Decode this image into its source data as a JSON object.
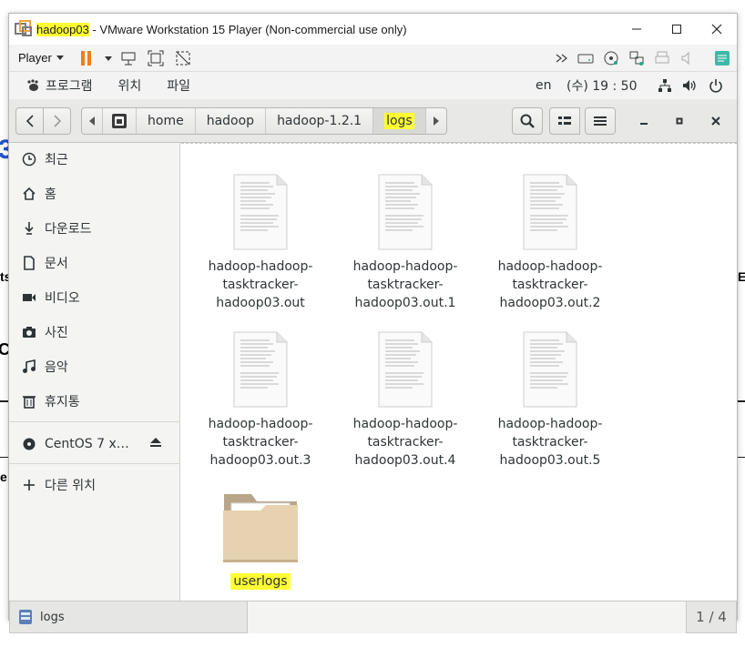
{
  "window": {
    "title_vm": "hadoop03",
    "title_rest": " - VMware Workstation 15 Player (Non-commercial use only)",
    "player_menu": "Player"
  },
  "gnome": {
    "applications": "프로그램",
    "places": "위치",
    "files": "파일",
    "input_lang": "en",
    "clock": "(수) 19 : 50"
  },
  "pathbar": {
    "crumbs": [
      "home",
      "hadoop",
      "hadoop-1.2.1",
      "logs"
    ]
  },
  "sidebar": {
    "items": [
      {
        "label": "최근",
        "icon": "clock-icon"
      },
      {
        "label": "홈",
        "icon": "home-icon"
      },
      {
        "label": "다운로드",
        "icon": "download-icon"
      },
      {
        "label": "문서",
        "icon": "document-icon"
      },
      {
        "label": "비디오",
        "icon": "video-icon"
      },
      {
        "label": "사진",
        "icon": "camera-icon"
      },
      {
        "label": "음악",
        "icon": "music-icon"
      },
      {
        "label": "휴지통",
        "icon": "trash-icon"
      }
    ],
    "device": "CentOS 7 x…",
    "other_locations": "다른 위치"
  },
  "files": [
    {
      "name1": "hadoop-hadoop-",
      "name2": "tasktracker-",
      "name3": "hadoop03.out",
      "type": "text"
    },
    {
      "name1": "hadoop-hadoop-",
      "name2": "tasktracker-",
      "name3": "hadoop03.out.1",
      "type": "text"
    },
    {
      "name1": "hadoop-hadoop-",
      "name2": "tasktracker-",
      "name3": "hadoop03.out.2",
      "type": "text"
    },
    {
      "name1": "hadoop-hadoop-",
      "name2": "tasktracker-",
      "name3": "hadoop03.out.3",
      "type": "text"
    },
    {
      "name1": "hadoop-hadoop-",
      "name2": "tasktracker-",
      "name3": "hadoop03.out.4",
      "type": "text"
    },
    {
      "name1": "hadoop-hadoop-",
      "name2": "tasktracker-",
      "name3": "hadoop03.out.5",
      "type": "text"
    },
    {
      "name1": "userlogs",
      "type": "folder"
    }
  ],
  "statusbar": {
    "label": "logs",
    "page": "1 / 4"
  },
  "colors": {
    "highlight": "#ffff33",
    "folder": "#e6d2b0",
    "pause": "#f07d1a"
  }
}
